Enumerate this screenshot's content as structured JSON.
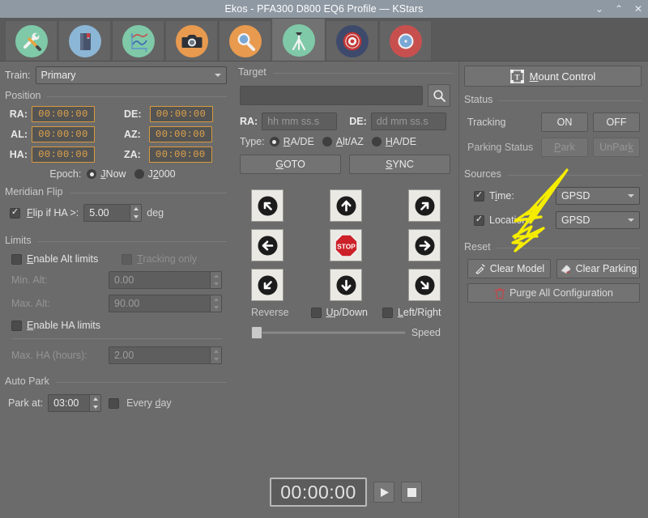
{
  "window": {
    "title": "Ekos - PFA300 D800 EQ6 Profile — KStars",
    "minimize": "⌄",
    "maximize": "⌃",
    "close": "✕"
  },
  "tabs": [
    {
      "name": "tab-setup",
      "icon": "wrench-screwdriver-icon",
      "active": false
    },
    {
      "name": "tab-logs",
      "icon": "book-icon",
      "active": false
    },
    {
      "name": "tab-analyze",
      "icon": "graph-icon",
      "active": false
    },
    {
      "name": "tab-capture",
      "icon": "camera-icon",
      "active": false
    },
    {
      "name": "tab-focus",
      "icon": "magnifier-icon",
      "active": false
    },
    {
      "name": "tab-mount",
      "icon": "tripod-icon",
      "active": true
    },
    {
      "name": "tab-align",
      "icon": "bullseye-icon",
      "active": false
    },
    {
      "name": "tab-guide",
      "icon": "compass-icon",
      "active": false
    }
  ],
  "train": {
    "label": "Train:",
    "value": "Primary",
    "edit_icon": "pencil-icon"
  },
  "position": {
    "group_label": "Position",
    "rows": [
      {
        "left_label": "RA:",
        "left_value": "00:00:00",
        "right_label": "DE:",
        "right_value": "00:00:00"
      },
      {
        "left_label": "AL:",
        "left_value": "00:00:00",
        "right_label": "AZ:",
        "right_value": "00:00:00"
      },
      {
        "left_label": "HA:",
        "left_value": "00:00:00",
        "right_label": "ZA:",
        "right_value": "00:00:00"
      }
    ],
    "epoch_label": "Epoch:",
    "epoch_options": [
      "JNow",
      "J2000"
    ],
    "epoch_selected": "JNow"
  },
  "meridian_flip": {
    "group_label": "Meridian Flip",
    "flip_checked": true,
    "flip_label": "Flip if HA >:",
    "flip_value": "5.00",
    "unit": "deg"
  },
  "limits": {
    "group_label": "Limits",
    "enable_alt_checked": false,
    "enable_alt_label": "Enable Alt limits",
    "tracking_only_checked": false,
    "tracking_only_label": "Tracking only",
    "min_alt_label": "Min. Alt:",
    "min_alt_value": "0.00",
    "max_alt_label": "Max. Alt:",
    "max_alt_value": "90.00",
    "enable_ha_checked": false,
    "enable_ha_label": "Enable HA limits",
    "max_ha_label": "Max. HA (hours):",
    "max_ha_value": "2.00"
  },
  "auto_park": {
    "group_label": "Auto Park",
    "park_at_label": "Park at:",
    "park_at_value": "03:00",
    "every_day_checked": false,
    "every_day_label": "Every day"
  },
  "target": {
    "group_label": "Target",
    "name_value": "",
    "name_placeholder": "",
    "search_icon": "search-icon",
    "ra_label": "RA:",
    "ra_placeholder": "hh mm ss.s",
    "ra_value": "",
    "de_label": "DE:",
    "de_placeholder": "dd mm ss.s",
    "de_value": "",
    "type_label": "Type:",
    "type_options": [
      "RA/DE",
      "Alt/AZ",
      "HA/DE"
    ],
    "type_selected": "RA/DE",
    "goto_label": "GOTO",
    "sync_label": "SYNC"
  },
  "dpad": {
    "buttons": [
      {
        "name": "move-north-west-button",
        "icon": "arrow-up-left-icon"
      },
      {
        "name": "move-north-button",
        "icon": "arrow-up-icon"
      },
      {
        "name": "move-north-east-button",
        "icon": "arrow-up-right-icon"
      },
      {
        "name": "move-west-button",
        "icon": "arrow-left-icon"
      },
      {
        "name": "stop-button",
        "icon": "stop-sign-icon",
        "label": "STOP"
      },
      {
        "name": "move-east-button",
        "icon": "arrow-right-icon"
      },
      {
        "name": "move-south-west-button",
        "icon": "arrow-down-left-icon"
      },
      {
        "name": "move-south-button",
        "icon": "arrow-down-icon"
      },
      {
        "name": "move-south-east-button",
        "icon": "arrow-down-right-icon"
      }
    ],
    "reverse_label": "Reverse",
    "up_down_checked": false,
    "up_down_label": "Up/Down",
    "left_right_checked": false,
    "left_right_label": "Left/Right",
    "speed_label": "Speed",
    "speed_percent": 0
  },
  "mount_control": {
    "label": "Mount Control",
    "icon": "mount-control-icon"
  },
  "status": {
    "group_label": "Status",
    "tracking_label": "Tracking",
    "tracking_on": "ON",
    "tracking_off": "OFF",
    "parking_label": "Parking Status",
    "park": "Park",
    "unpark": "UnPark"
  },
  "sources": {
    "group_label": "Sources",
    "time_checked": true,
    "time_label": "Time:",
    "time_value": "GPSD",
    "location_checked": true,
    "location_label": "Location:",
    "location_value": "GPSD"
  },
  "reset": {
    "group_label": "Reset",
    "clear_model_label": "Clear  Model",
    "clear_model_icon": "broom-icon",
    "clear_parking_label": "Clear Parking",
    "clear_parking_icon": "eraser-icon",
    "purge_label": "Purge All Configuration",
    "purge_icon": "trash-icon"
  },
  "footer": {
    "clock_value": "00:00:00",
    "play_icon": "play-icon",
    "stop_icon": "stop-square-icon"
  },
  "annotations": {
    "arrow_color": "#f5ec00",
    "arrow_count": 2
  }
}
